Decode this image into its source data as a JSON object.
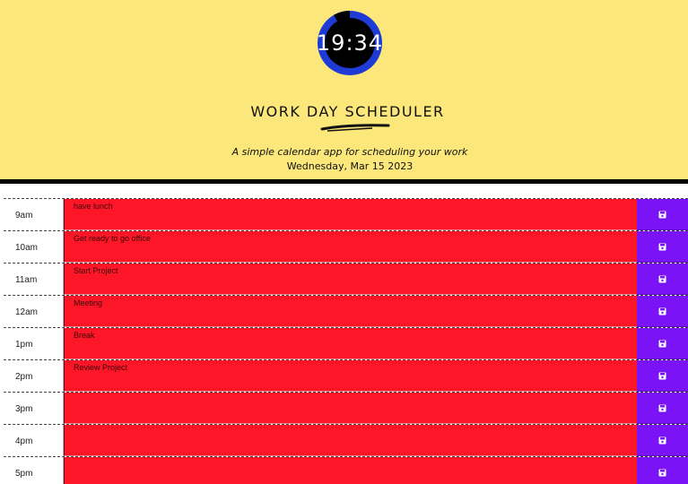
{
  "header": {
    "clock_time": "19:34",
    "title": "Work Day Scheduler",
    "subtitle": "A simple calendar app for scheduling your work",
    "date": "Wednesday, Mar 15 2023"
  },
  "colors": {
    "header_bg": "#fbe77a",
    "past": "#fc1627",
    "save": "#7a13f5",
    "clock_ring": "#1f3bd6"
  },
  "blocks": [
    {
      "hour": "9am",
      "text": "have lunch"
    },
    {
      "hour": "10am",
      "text": "Get ready to go office"
    },
    {
      "hour": "11am",
      "text": "Start Project"
    },
    {
      "hour": "12am",
      "text": "Meeting"
    },
    {
      "hour": "1pm",
      "text": "Break"
    },
    {
      "hour": "2pm",
      "text": "Review Project"
    },
    {
      "hour": "3pm",
      "text": ""
    },
    {
      "hour": "4pm",
      "text": ""
    },
    {
      "hour": "5pm",
      "text": ""
    }
  ],
  "icons": {
    "save": "floppy-disk-icon"
  }
}
